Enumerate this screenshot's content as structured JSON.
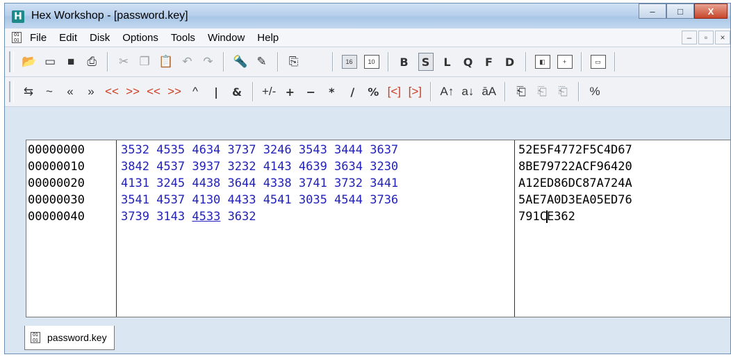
{
  "window": {
    "title": "Hex Workshop - [password.key]",
    "app_icon": "H",
    "controls": {
      "minimize": "–",
      "maximize": "□",
      "close": "X"
    }
  },
  "menu": {
    "items": [
      "File",
      "Edit",
      "Disk",
      "Options",
      "Tools",
      "Window",
      "Help"
    ],
    "mdi": [
      "–",
      "▫",
      "×"
    ]
  },
  "toolbar1": {
    "icons": [
      "open-icon",
      "save-as-icon",
      "save-icon",
      "print-icon",
      "cut-icon",
      "copy-icon",
      "paste-icon",
      "undo-icon",
      "redo-icon",
      "find-icon",
      "replace-icon",
      "goto-icon",
      "hex-base-icon",
      "decimal-base-icon",
      "bookmark-icon",
      "insert-icon",
      "compare-icon"
    ],
    "base16": "16",
    "base10": "10",
    "data_types": [
      "B",
      "S",
      "L",
      "Q",
      "F",
      "D"
    ]
  },
  "toolbar2": {
    "ops": [
      "⇆",
      "~",
      "«",
      "»",
      "<<",
      ">>",
      "<<",
      ">>",
      "^",
      "|",
      "&",
      "+/-",
      "+",
      "−",
      "*",
      "/",
      "%",
      "[<]",
      "[>]",
      "A↑",
      "a↓",
      "āA"
    ]
  },
  "document": {
    "rows": [
      {
        "address": "00000000",
        "hex": "3532 4535 4634 3737 3246 3543 3444 3637",
        "ascii": "52E5F4772F5C4D67"
      },
      {
        "address": "00000010",
        "hex": "3842 4537 3937 3232 4143 4639 3634 3230",
        "ascii": "8BE79722ACF96420"
      },
      {
        "address": "00000020",
        "hex": "4131 3245 4438 3644 4338 3741 3732 3441",
        "ascii": "A12ED86DC87A724A"
      },
      {
        "address": "00000030",
        "hex": "3541 4537 4130 4433 4541 3035 4544 3736",
        "ascii": "5AE7A0D3EA05ED76"
      }
    ],
    "last_row": {
      "address": "00000040",
      "hex_before": "3739 3143 ",
      "hex_cursor_char": "4",
      "hex_cursor_rest": "533",
      "hex_after": " 3632",
      "ascii_before": "791C",
      "ascii_after": "E362"
    }
  },
  "tab": {
    "label": "password.key"
  }
}
